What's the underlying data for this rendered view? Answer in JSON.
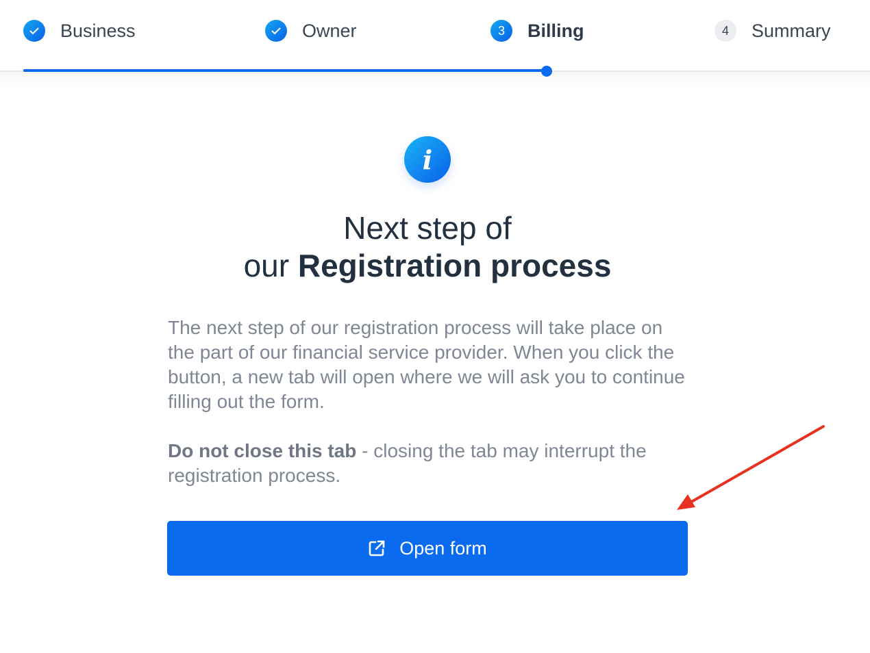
{
  "stepper": {
    "steps": [
      {
        "label": "Business",
        "number": "1",
        "state": "done",
        "icon": "check-icon"
      },
      {
        "label": "Owner",
        "number": "2",
        "state": "done",
        "icon": "check-icon"
      },
      {
        "label": "Billing",
        "number": "3",
        "state": "active"
      },
      {
        "label": "Summary",
        "number": "4",
        "state": "todo"
      }
    ],
    "accent_color": "#0b6bee",
    "current_step": 3
  },
  "main": {
    "icon": "info-icon",
    "heading_line1": "Next step of",
    "heading_line2_prefix": "our ",
    "heading_line2_strong": "Registration process",
    "description": "The next step of our registration process will take place on the part of our financial service provider. When you click the button, a new tab will open where we will ask you to continue filling out the form.",
    "warning_strong": "Do not close this tab",
    "warning_rest": " - closing the tab may interrupt the registration process.",
    "button_label": "Open form",
    "button_icon": "external-link-icon"
  },
  "annotation": {
    "type": "arrow",
    "color": "#e8321f",
    "points_to": "open-form-button"
  }
}
